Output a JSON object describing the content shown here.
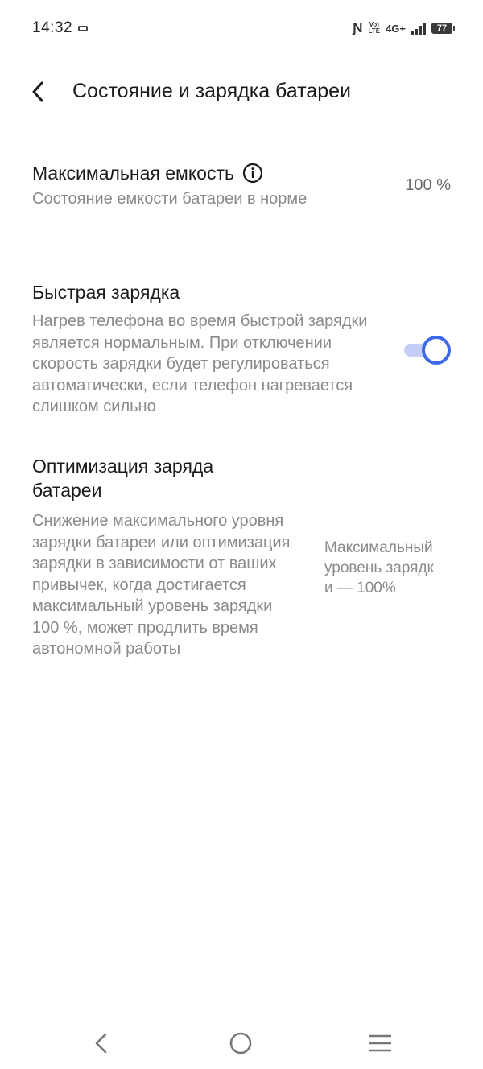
{
  "status_bar": {
    "time": "14:32",
    "volte_top": "Vo)",
    "volte_bottom": "LTE",
    "network": "4G+",
    "battery": "77"
  },
  "header": {
    "title": "Состояние и зарядка батареи"
  },
  "max_capacity": {
    "title": "Максимальная емкость",
    "description": "Состояние емкости батареи в норме",
    "value": "100 %"
  },
  "fast_charging": {
    "title": "Быстрая зарядка",
    "description": "Нагрев телефона во время быстрой зарядки является нормальным. При отключении скорость зарядки будет регулироваться автоматически, если телефон нагревается слишком сильно",
    "enabled": true
  },
  "charge_optimization": {
    "title": "Оптимизация заряда батареи",
    "description": "Снижение максимального уровня зарядки батареи или оптимизация зарядки в зависимости от ваших привычек, когда достигается максимальный уровень зарядки 100 %, может продлить время автономной работы",
    "value": "Максимальный уровень зарядки — 100%"
  },
  "colors": {
    "accent": "#3d68e6",
    "toggle_track": "#c3cdf6",
    "secondary_text": "#8a8a8a"
  },
  "icons": {
    "back": "chevron-left-icon",
    "info": "info-icon",
    "nav_back": "nav-back-icon",
    "nav_home": "nav-home-icon",
    "nav_menu": "nav-menu-icon"
  }
}
